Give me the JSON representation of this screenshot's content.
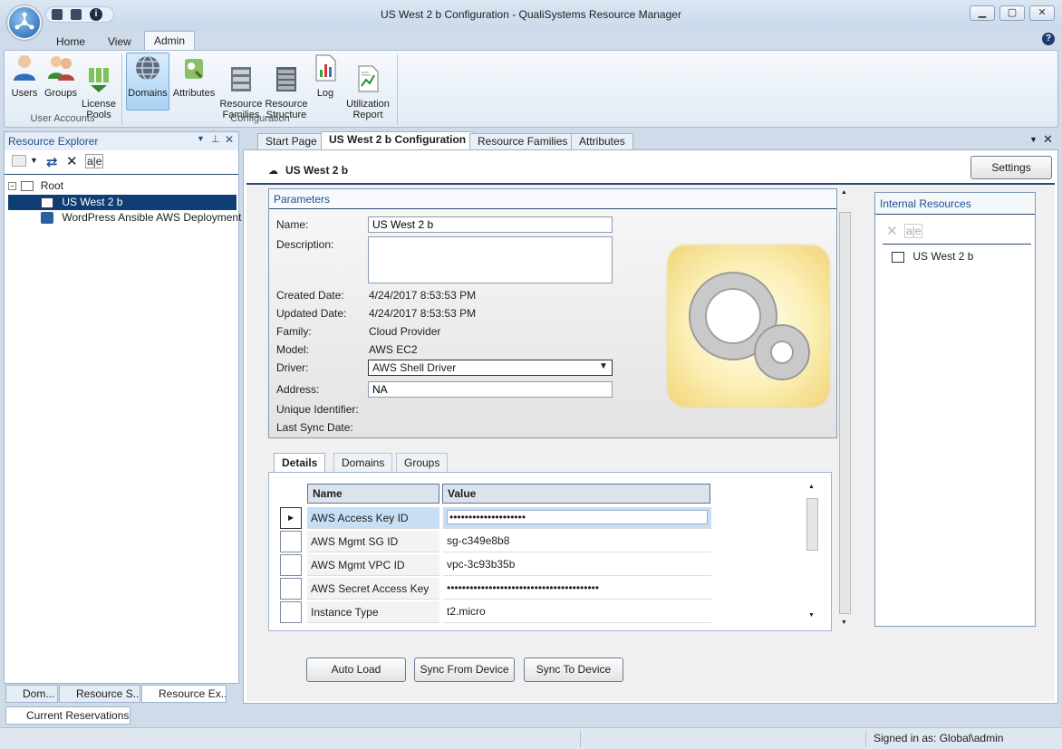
{
  "window": {
    "title": "US West 2 b Configuration - QualiSystems Resource Manager"
  },
  "ribbon": {
    "tabs": [
      "Home",
      "View",
      "Admin"
    ],
    "buttons": {
      "users": "Users",
      "groups": "Groups",
      "license": "License\nPools",
      "domains": "Domains",
      "attributes": "Attributes",
      "resource_families": "Resource\nFamilies",
      "resource_structure": "Resource\nStructure",
      "log": "Log",
      "utilization": "Utilization\nReport"
    },
    "groups": {
      "user_accounts": "User Accounts",
      "configuration": "Configuration"
    }
  },
  "resource_explorer": {
    "title": "Resource Explorer",
    "tree": {
      "root": "Root",
      "item1": "US West 2 b",
      "item2": "WordPress Ansible AWS Deployment"
    }
  },
  "bottom_tabs": {
    "dom": "Dom...",
    "resource_s": "Resource S...",
    "resource_ex": "Resource Ex...",
    "current_reservations": "Current Reservations"
  },
  "status": {
    "signed_in": "Signed in as: Global\\admin"
  },
  "doc_tabs": [
    "Start Page",
    "US West 2 b Configuration",
    "Resource Families",
    "Attributes"
  ],
  "resource": {
    "heading": "US West 2 b",
    "settings_label": "Settings"
  },
  "parameters": {
    "title": "Parameters",
    "labels": {
      "name": "Name:",
      "description": "Description:",
      "created": "Created Date:",
      "updated": "Updated Date:",
      "family": "Family:",
      "model": "Model:",
      "driver": "Driver:",
      "address": "Address:",
      "uid": "Unique Identifier:",
      "sync": "Last Sync Date:"
    },
    "values": {
      "name": "US West 2 b",
      "description": "",
      "created": "4/24/2017 8:53:53 PM",
      "updated": "4/24/2017 8:53:53 PM",
      "family": "Cloud Provider",
      "model": "AWS EC2",
      "driver": "AWS Shell Driver",
      "address": "NA"
    }
  },
  "internal_resources": {
    "title": "Internal Resources",
    "item": "US West 2 b"
  },
  "details": {
    "tabs": [
      "Details",
      "Domains",
      "Groups"
    ],
    "columns": [
      "Name",
      "Value"
    ],
    "rows": [
      {
        "name": "AWS Access Key ID",
        "value": "••••••••••••••••••••"
      },
      {
        "name": "AWS Mgmt SG ID",
        "value": "sg-c349e8b8"
      },
      {
        "name": "AWS Mgmt VPC ID",
        "value": "vpc-3c93b35b"
      },
      {
        "name": "AWS Secret Access Key",
        "value": "••••••••••••••••••••••••••••••••••••••••"
      },
      {
        "name": "Instance Type",
        "value": "t2.micro"
      }
    ]
  },
  "actions": {
    "auto_load": "Auto Load",
    "sync_from": "Sync From Device",
    "sync_to": "Sync To Device"
  }
}
